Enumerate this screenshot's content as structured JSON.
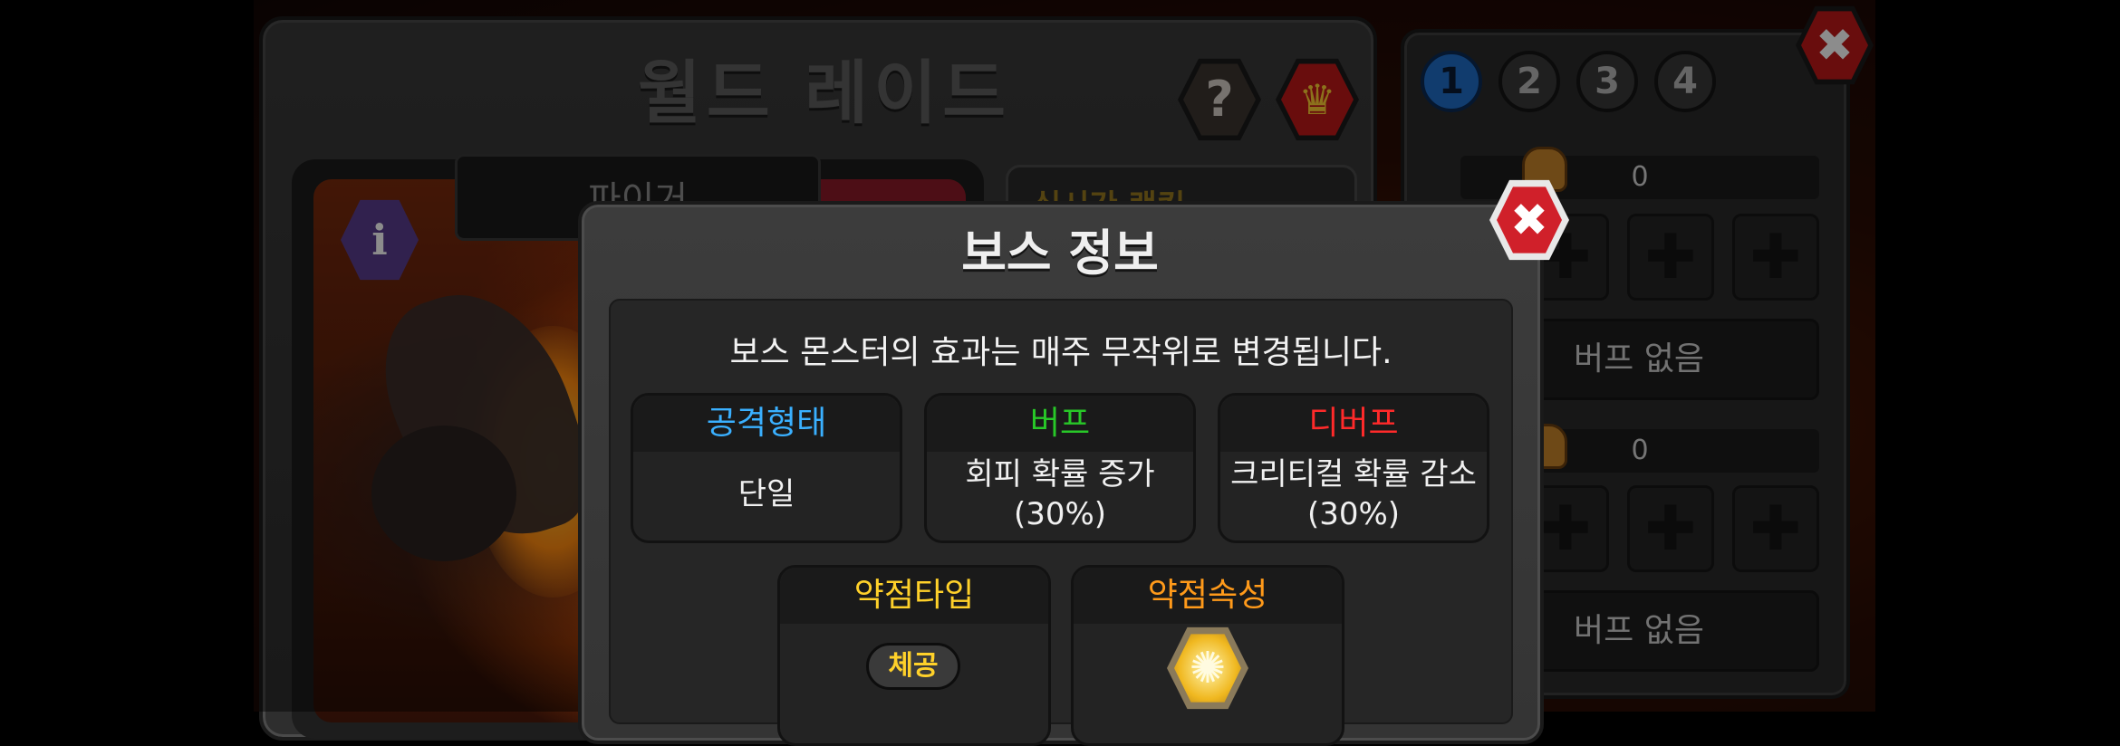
{
  "main_panel": {
    "title": "월드 레이드",
    "help_label": "?",
    "crown_label": "♛",
    "boss_name": "파이거",
    "info_label": "i",
    "rank_button_label": "실시간 랭킹"
  },
  "side_panel": {
    "close_label": "✖",
    "tabs": [
      "1",
      "2",
      "3",
      "4"
    ],
    "active_tab": "1",
    "parties": [
      {
        "score": "0",
        "slot_label": "✚",
        "buff_text": "버프 없음"
      },
      {
        "score": "0",
        "slot_label": "✚",
        "buff_text": "버프 없음"
      }
    ]
  },
  "modal": {
    "title": "보스 정보",
    "close_label": "✖",
    "description": "보스 몬스터의 효과는 매주 무작위로 변경됩니다.",
    "attack_type": {
      "label": "공격형태",
      "value": "단일",
      "color": "#3ab0ff"
    },
    "buff": {
      "label": "버프",
      "line1": "회피 확률 증가",
      "line2": "(30%)",
      "color": "#28c828"
    },
    "debuff": {
      "label": "디버프",
      "line1": "크리티컬 확률 감소",
      "line2": "(30%)",
      "color": "#ff2a2a"
    },
    "weak_type": {
      "label": "약점타입",
      "value": "체공",
      "color": "#ffd12a"
    },
    "weak_element": {
      "label": "약점속성",
      "icon": "light-element-icon",
      "color": "#ff9a1a"
    }
  },
  "colors": {
    "active_tab": "#1f6ec8",
    "close_red": "#d0202a",
    "panel_bg": "#3a3a3a"
  }
}
